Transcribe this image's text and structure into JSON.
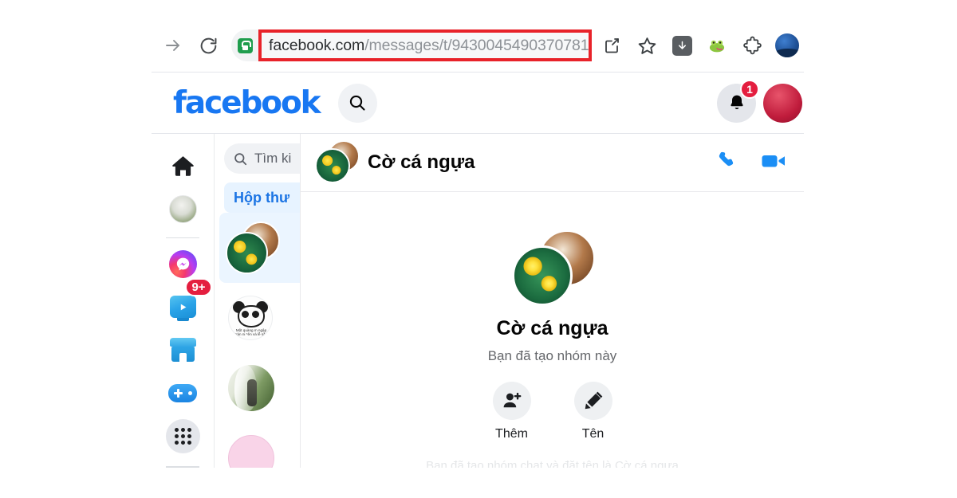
{
  "browser": {
    "forward_icon": "arrow-right-icon",
    "reload_icon": "reload-icon",
    "lock_icon": "padlock-secure-icon",
    "url_domain": "facebook.com",
    "url_path": "/messages/t/9430045490370781",
    "url_full": "facebook.com/messages/t/9430045490370781",
    "highlight_color": "#e8232a",
    "actions": [
      {
        "name": "share-icon",
        "label": "Share"
      },
      {
        "name": "bookmark-star-icon",
        "label": "Bookmark"
      },
      {
        "name": "download-icon",
        "label": "Downloads"
      },
      {
        "name": "extension-frog-icon",
        "label": "Extension"
      },
      {
        "name": "puzzle-piece-icon",
        "label": "Extensions"
      },
      {
        "name": "browser-profile-avatar",
        "label": "Profile"
      }
    ]
  },
  "facebook_header": {
    "logo": "facebook",
    "search_icon": "search-icon",
    "bell_icon": "notification-bell-icon",
    "bell_badge": "1",
    "badge_color": "#e41e3f",
    "accent_color": "#1877f2",
    "avatar": "user-avatar"
  },
  "rail": {
    "items": [
      {
        "name": "home",
        "icon": "home-icon"
      },
      {
        "name": "profile",
        "icon": "profile-avatar"
      },
      {
        "name": "messenger",
        "icon": "messenger-icon",
        "active": true
      },
      {
        "name": "watch",
        "icon": "watch-video-icon",
        "badge": "9+"
      },
      {
        "name": "marketplace",
        "icon": "marketplace-shop-icon"
      },
      {
        "name": "gaming",
        "icon": "gaming-controller-icon"
      },
      {
        "name": "menu",
        "icon": "grid-menu-icon"
      }
    ]
  },
  "chat_list": {
    "search_placeholder": "Tìm ki",
    "search_icon": "search-icon",
    "tab_label": "Hộp thư",
    "conversations": [
      {
        "name": "group-co-ca-ngua",
        "avatar": "stacked-group-avatar",
        "active": true
      },
      {
        "name": "panda-contact",
        "avatar": "panda-meme-avatar",
        "online": true,
        "meme_text": "Một quàng m ngập tràn ni *ěn và lễ sắn"
      },
      {
        "name": "photo-contact",
        "avatar": "person-photo-avatar"
      },
      {
        "name": "pink-contact",
        "avatar": "pink-avatar"
      }
    ]
  },
  "thread": {
    "title": "Cờ cá ngựa",
    "avatar": "stacked-group-avatar",
    "call_icon": "phone-call-icon",
    "video_icon": "video-camera-icon",
    "action_color": "#1b8ef5",
    "group_name": "Cờ cá ngựa",
    "group_subtitle": "Bạn đã tạo nhóm này",
    "actions": [
      {
        "name": "add-member",
        "icon": "add-person-icon",
        "label": "Thêm"
      },
      {
        "name": "rename-group",
        "icon": "pencil-edit-icon",
        "label": "Tên"
      }
    ],
    "faded_notice": "Bạn đã tạo nhóm chat và đặt tên là Cờ cá ngựa"
  }
}
